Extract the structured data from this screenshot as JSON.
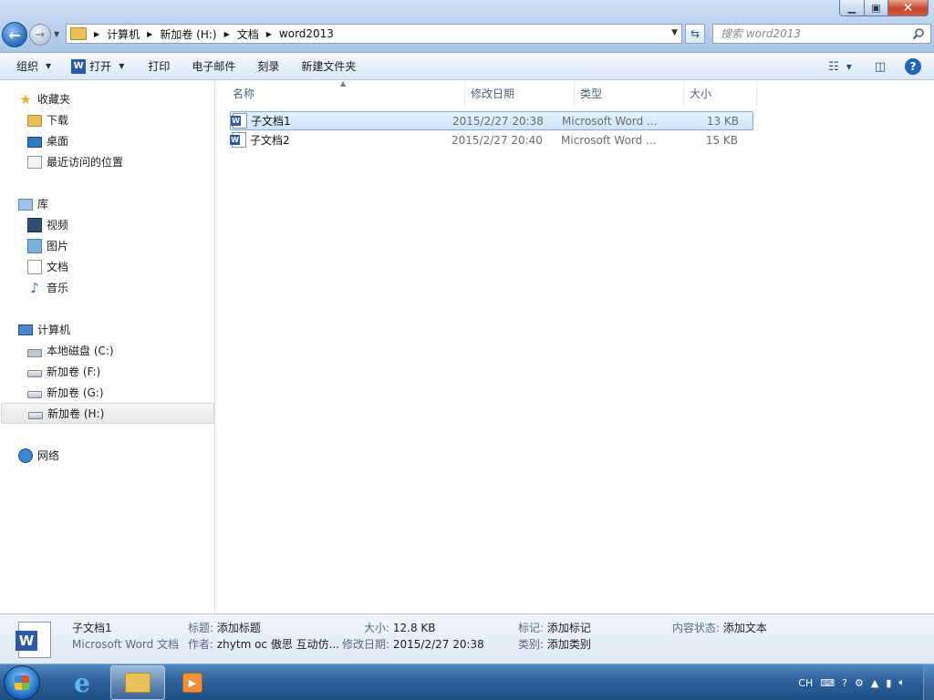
{
  "window": {
    "controls": {
      "minimize": "▁",
      "maximize": "▣",
      "close": "✕"
    }
  },
  "address": {
    "crumbs": [
      "计算机",
      "新加卷 (H:)",
      "文档",
      "word2013"
    ]
  },
  "search": {
    "placeholder": "搜索 word2013"
  },
  "toolbar": {
    "organize": "组织",
    "open": "打开",
    "print": "打印",
    "email": "电子邮件",
    "burn": "刻录",
    "new_folder": "新建文件夹"
  },
  "nav": {
    "favorites": {
      "label": "收藏夹",
      "items": [
        "下载",
        "桌面",
        "最近访问的位置"
      ]
    },
    "libraries": {
      "label": "库",
      "items": [
        "视频",
        "图片",
        "文档",
        "音乐"
      ]
    },
    "computer": {
      "label": "计算机",
      "items": [
        "本地磁盘 (C:)",
        "新加卷 (F:)",
        "新加卷 (G:)",
        "新加卷 (H:)"
      ]
    },
    "network": {
      "label": "网络"
    }
  },
  "columns": {
    "name": "名称",
    "date": "修改日期",
    "type": "类型",
    "size": "大小"
  },
  "files": [
    {
      "name": "子文档1",
      "date": "2015/2/27 20:38",
      "type": "Microsoft Word ...",
      "size": "13 KB",
      "selected": true
    },
    {
      "name": "子文档2",
      "date": "2015/2/27 20:40",
      "type": "Microsoft Word ...",
      "size": "15 KB",
      "selected": false
    }
  ],
  "details": {
    "filename": "子文档1",
    "filetype": "Microsoft Word 文档",
    "title_label": "标题:",
    "title_value": "添加标题",
    "author_label": "作者:",
    "author_value": "zhytm oc 傲思  互动仿...",
    "size_label": "大小:",
    "size_value": "12.8 KB",
    "modified_label": "修改日期:",
    "modified_value": "2015/2/27 20:38",
    "tags_label": "标记:",
    "tags_value": "添加标记",
    "category_label": "类别:",
    "category_value": "添加类别",
    "status_label": "内容状态:",
    "status_value": "添加文本"
  },
  "taskbar": {
    "tray": {
      "lang": "CH"
    }
  },
  "colors": {
    "accent": "#2a6fb0",
    "selection": "#cfe3fb",
    "selection_border": "#84acdd"
  }
}
